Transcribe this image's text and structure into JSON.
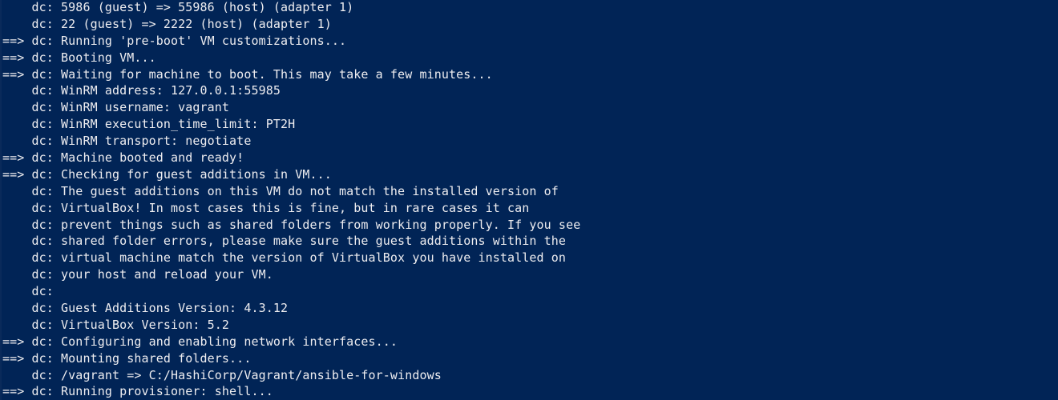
{
  "terminal": {
    "background": "#012456",
    "foreground": "#eeedf0",
    "lines": [
      "    dc: 5986 (guest) => 55986 (host) (adapter 1)",
      "    dc: 22 (guest) => 2222 (host) (adapter 1)",
      "==> dc: Running 'pre-boot' VM customizations...",
      "==> dc: Booting VM...",
      "==> dc: Waiting for machine to boot. This may take a few minutes...",
      "    dc: WinRM address: 127.0.0.1:55985",
      "    dc: WinRM username: vagrant",
      "    dc: WinRM execution_time_limit: PT2H",
      "    dc: WinRM transport: negotiate",
      "==> dc: Machine booted and ready!",
      "==> dc: Checking for guest additions in VM...",
      "    dc: The guest additions on this VM do not match the installed version of",
      "    dc: VirtualBox! In most cases this is fine, but in rare cases it can",
      "    dc: prevent things such as shared folders from working properly. If you see",
      "    dc: shared folder errors, please make sure the guest additions within the",
      "    dc: virtual machine match the version of VirtualBox you have installed on",
      "    dc: your host and reload your VM.",
      "    dc:",
      "    dc: Guest Additions Version: 4.3.12",
      "    dc: VirtualBox Version: 5.2",
      "==> dc: Configuring and enabling network interfaces...",
      "==> dc: Mounting shared folders...",
      "    dc: /vagrant => C:/HashiCorp/Vagrant/ansible-for-windows",
      "==> dc: Running provisioner: shell..."
    ]
  }
}
